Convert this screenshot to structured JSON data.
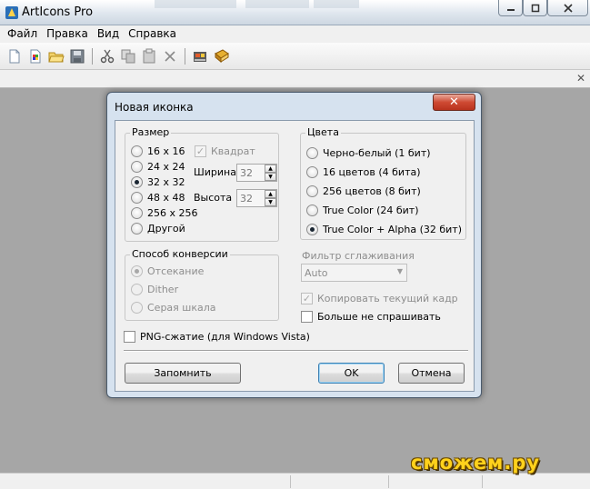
{
  "window": {
    "title": "ArtIcons Pro"
  },
  "menu": [
    "Файл",
    "Правка",
    "Вид",
    "Справка"
  ],
  "dialog": {
    "title": "Новая иконка",
    "size_group": {
      "legend": "Размер",
      "options": [
        "16 x 16",
        "24 x 24",
        "32 x 32",
        "48 x 48",
        "256 x 256",
        "Другой"
      ],
      "selected": "32 x 32",
      "square_label": "Квадрат",
      "width_label": "Ширина",
      "width_value": "32",
      "height_label": "Высота",
      "height_value": "32"
    },
    "colors_group": {
      "legend": "Цвета",
      "options": [
        "Черно-белый (1 бит)",
        "16 цветов (4 бита)",
        "256 цветов (8 бит)",
        "True Color (24 бит)",
        "True Color + Alpha (32 бит)"
      ],
      "selected": "True Color + Alpha (32 бит)"
    },
    "conversion_group": {
      "legend": "Способ конверсии",
      "options": [
        "Отсекание",
        "Dither",
        "Серая шкала"
      ],
      "selected": "Отсекание"
    },
    "smoothing": {
      "label": "Фильтр сглаживания",
      "value": "Auto"
    },
    "copy_frame_label": "Копировать текущий кадр",
    "dont_ask_label": "Больше не спрашивать",
    "png_label": "PNG-сжатие (для Windows Vista)",
    "buttons": {
      "remember": "Запомнить",
      "ok": "OK",
      "cancel": "Отмена"
    }
  },
  "watermark": "сможем.ру"
}
